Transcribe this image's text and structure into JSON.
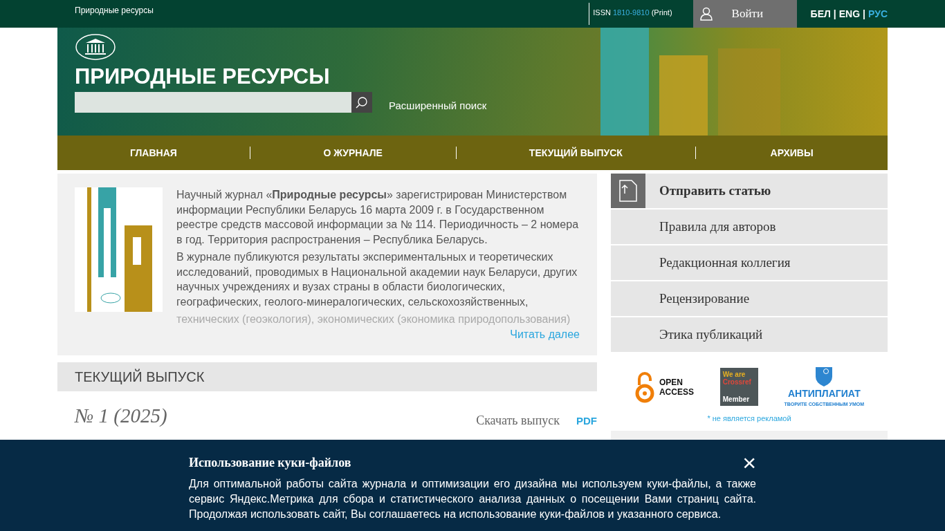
{
  "topbar": {
    "site_name": "Природные ресурсы",
    "issn_label": "ISSN",
    "issn": "1810-9810",
    "issn_type": "(Print)",
    "login": "Войти",
    "lang_separator": "|",
    "languages": [
      {
        "label": "БЕЛ",
        "selected": false
      },
      {
        "label": "ENG",
        "selected": false
      },
      {
        "label": "РУС",
        "selected": true
      }
    ]
  },
  "header": {
    "title": "ПРИРОДНЫЕ РЕСУРСЫ",
    "advanced_search": "Расширенный поиск"
  },
  "nav": [
    "ГЛАВНАЯ",
    "О ЖУРНАЛЕ",
    "ТЕКУЩИЙ ВЫПУСК",
    "АРХИВЫ"
  ],
  "about": {
    "paragraphs": [
      "Научный журнал «**Природные ресурсы**» зарегистрирован Министерством информации Республики Беларусь 16 марта 2009 г. в Государственном реестре средств массовой информации за № 114. Периодичность – 2 номера в год. Территория распространения – Республика Беларусь.",
      "В журнале публикуются результаты экспериментальных и теоретических исследований, проводимых в Национальной академии наук Беларуси, других научных учреждениях и вузах страны в области биологических, географических, геолого-минералогических, сельскохозяйственных,"
    ],
    "faded_text": "технических (геоэкология), экономических (экономика природопользования)",
    "read_more": "Читать далее"
  },
  "current_issue": {
    "heading": "ТЕКУЩИЙ ВЫПУСК",
    "issue": "№ 1 (2025)",
    "download": "Скачать выпуск",
    "format": "PDF"
  },
  "sidebar": {
    "items": [
      {
        "label": "Отправить статью",
        "kind": "primary"
      },
      {
        "label": "Правила для авторов",
        "kind": "plain"
      },
      {
        "label": "Редакционная коллегия",
        "kind": "plain"
      },
      {
        "label": "Рецензирование",
        "kind": "plain"
      },
      {
        "label": "Этика публикаций",
        "kind": "plain"
      }
    ],
    "badges": {
      "open_access": [
        "OPEN",
        "ACCESS"
      ],
      "crossref": [
        "We are",
        "Crossref",
        "Member"
      ],
      "antiplagiat": [
        "АНТИПЛАГИАТ",
        "ТВОРИТЕ СОБСТВЕННЫМ УМОМ"
      ]
    },
    "disclaimer": "* не является рекламой"
  },
  "cookie": {
    "title": "Использование куки-файлов",
    "text": "Для оптимальной работы сайта журнала и оптимизации его дизайна мы используем куки-файлы, а также сервис Яндекс.Метрика для сбора и статистического анализа данных о посещении Вами страниц сайта. Продолжая использовать сайт, Вы соглашаетесь на использование куки-файлов и указанного сервиса.",
    "close": "×"
  }
}
